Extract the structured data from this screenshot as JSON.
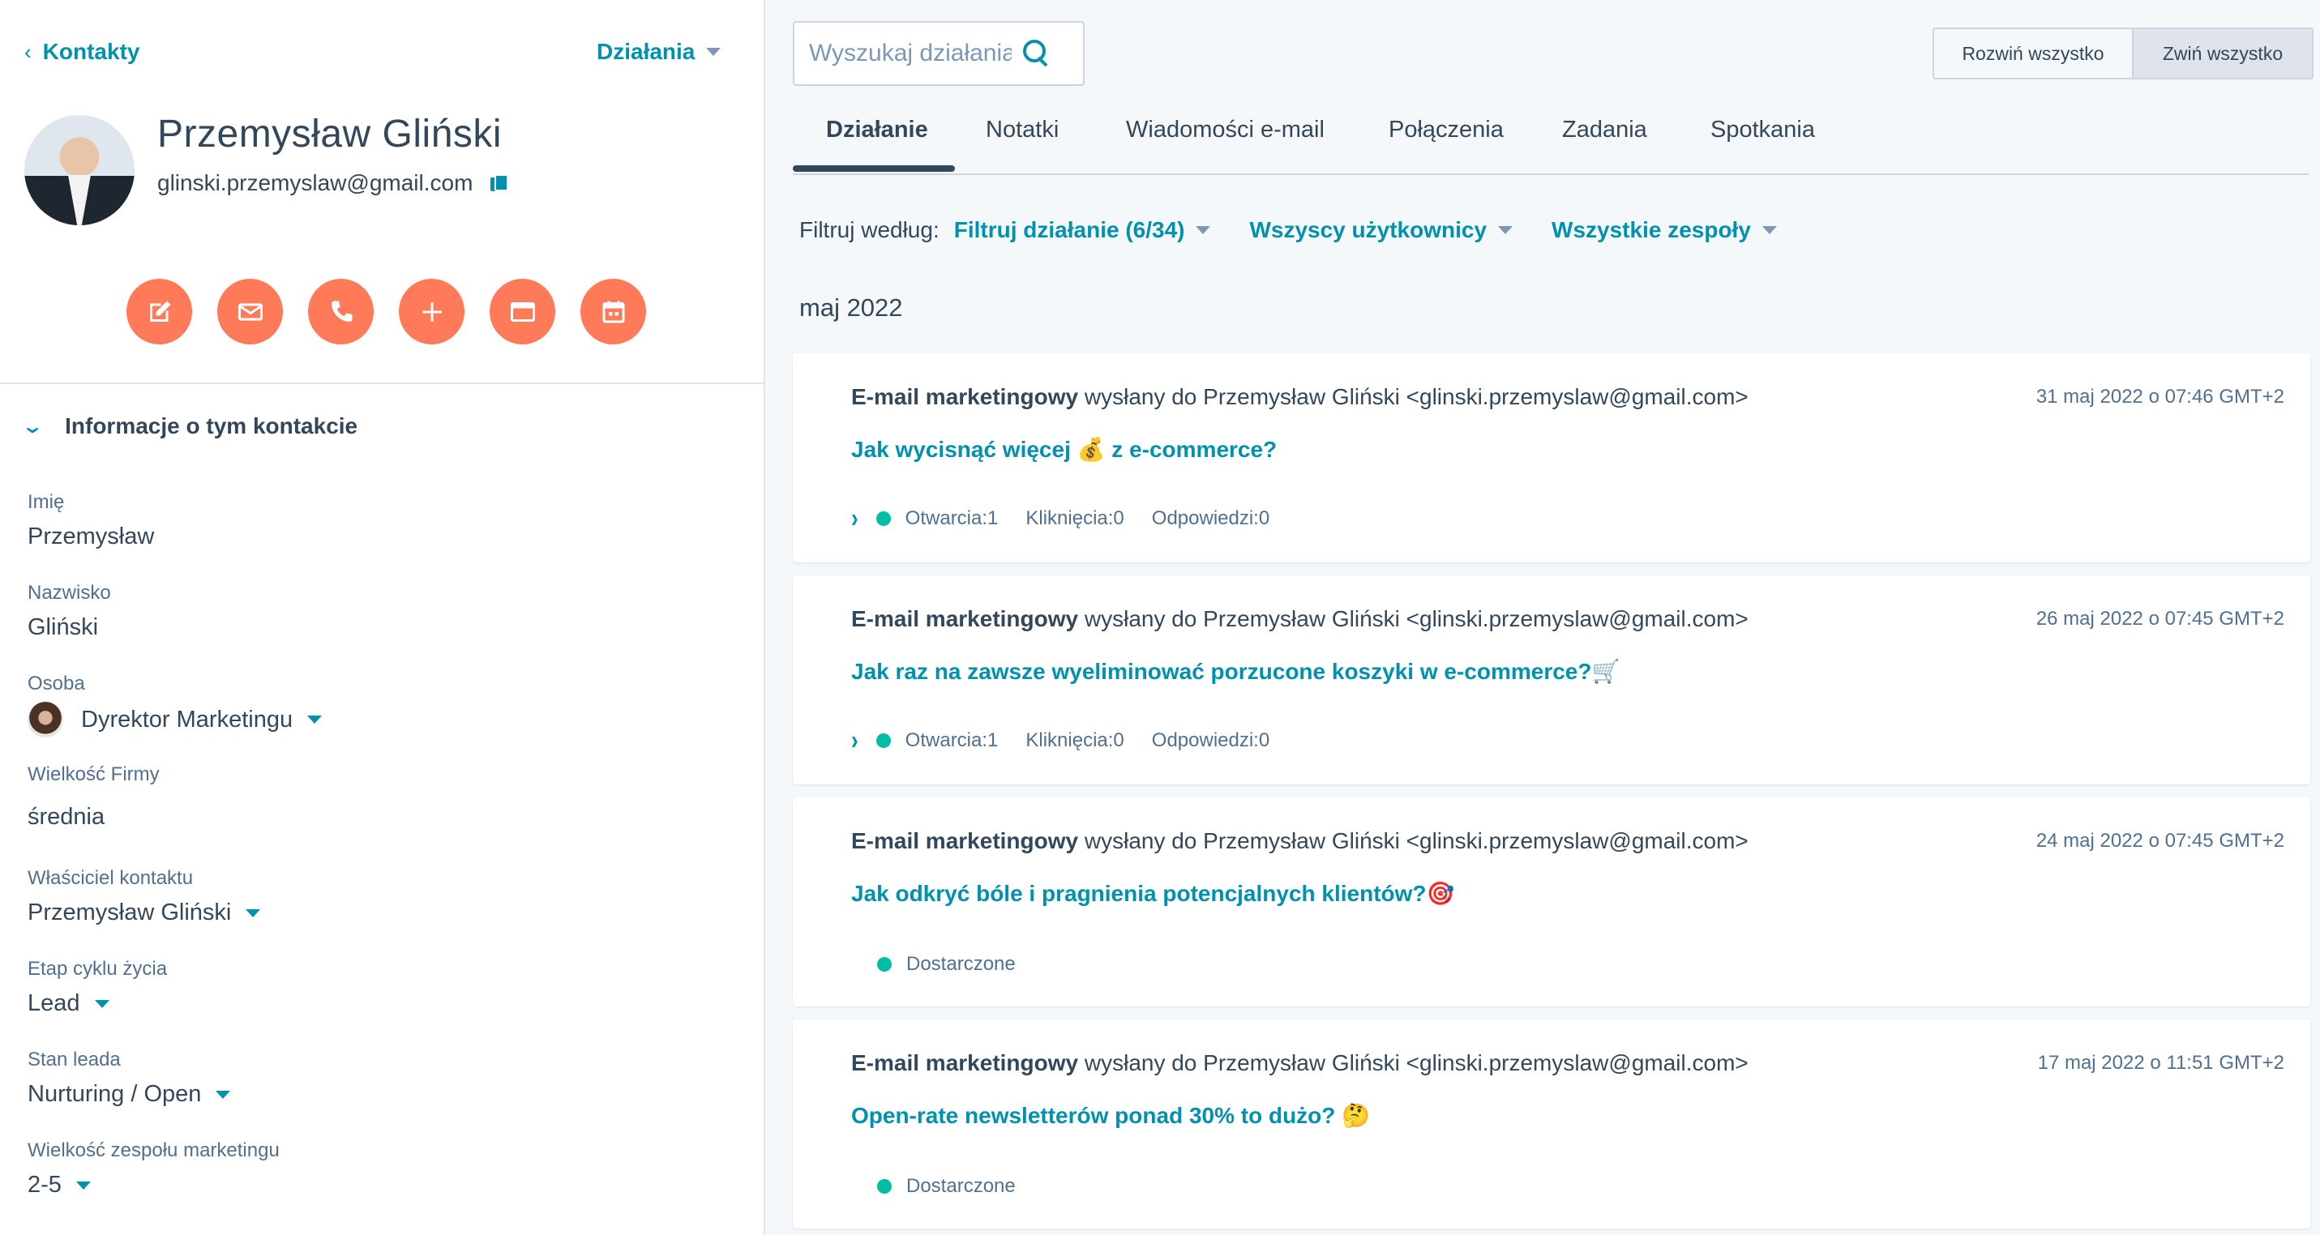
{
  "sidebar": {
    "back_label": "Kontakty",
    "actions_label": "Działania",
    "contact": {
      "name": "Przemysław Gliński",
      "email": "glinski.przemyslaw@gmail.com"
    },
    "action_buttons": [
      {
        "icon": "note-icon"
      },
      {
        "icon": "email-icon"
      },
      {
        "icon": "phone-icon"
      },
      {
        "icon": "plus-icon"
      },
      {
        "icon": "browser-icon"
      },
      {
        "icon": "calendar-icon"
      }
    ],
    "section_title": "Informacje o tym kontakcie",
    "fields": [
      {
        "label": "Imię",
        "value": "Przemysław"
      },
      {
        "label": "Nazwisko",
        "value": "Gliński"
      },
      {
        "label": "Osoba",
        "value": "Dyrektor Marketingu"
      },
      {
        "label": "Wielkość Firmy",
        "value": "średnia"
      },
      {
        "label": "Właściciel kontaktu",
        "value": "Przemysław Gliński"
      },
      {
        "label": "Etap cyklu życia",
        "value": "Lead"
      },
      {
        "label": "Stan leada",
        "value": "Nurturing / Open"
      },
      {
        "label": "Wielkość zespołu marketingu",
        "value": "2-5"
      }
    ]
  },
  "search": {
    "placeholder": "Wyszukaj działania"
  },
  "toggle": {
    "expand_all": "Rozwiń wszystko",
    "collapse_all": "Zwiń wszystko"
  },
  "tabs": [
    "Działanie",
    "Notatki",
    "Wiadomości e-mail",
    "Połączenia",
    "Zadania",
    "Spotkania"
  ],
  "filters": {
    "label": "Filtruj według:",
    "activity": "Filtruj działanie (6/34)",
    "users": "Wszyscy użytkownicy",
    "teams": "Wszystkie zespoły"
  },
  "month": "maj 2022",
  "activities": [
    {
      "type": "E-mail marketingowy",
      "rest": " wysłany do Przemysław Gliński <glinski.przemyslaw@gmail.com>",
      "date": "31 maj 2022 o 07:46 GMT+2",
      "subject": "Jak wycisnąć więcej ",
      "emoji_mid": "💰",
      "subject_tail": " z e-commerce?",
      "stats": [
        "Otwarcia:1",
        "Kliknięcia:0",
        "Odpowiedzi:0"
      ]
    },
    {
      "type": "E-mail marketingowy",
      "rest": " wysłany do Przemysław Gliński <glinski.przemyslaw@gmail.com>",
      "date": "26 maj 2022 o 07:45 GMT+2",
      "subject": "Jak raz na zawsze wyeliminować porzucone koszyki w e-commerce?",
      "emoji_end": "🛒",
      "stats": [
        "Otwarcia:1",
        "Kliknięcia:0",
        "Odpowiedzi:0"
      ]
    },
    {
      "type": "E-mail marketingowy",
      "rest": " wysłany do Przemysław Gliński <glinski.przemyslaw@gmail.com>",
      "date": "24 maj 2022 o 07:45 GMT+2",
      "subject": "Jak odkryć bóle i pragnienia potencjalnych klientów?",
      "emoji_end": "🎯",
      "status": "Dostarczone"
    },
    {
      "type": "E-mail marketingowy",
      "rest": " wysłany do Przemysław Gliński <glinski.przemyslaw@gmail.com>",
      "date": "17 maj 2022 o 11:51 GMT+2",
      "subject": "Open-rate newsletterów ponad 30% to dużo?",
      "emoji_end": "🤔",
      "status": "Dostarczone"
    }
  ],
  "colors": {
    "accent": "#0091ae",
    "action": "#ff7a59",
    "text": "#33475b",
    "status": "#00bda5"
  }
}
